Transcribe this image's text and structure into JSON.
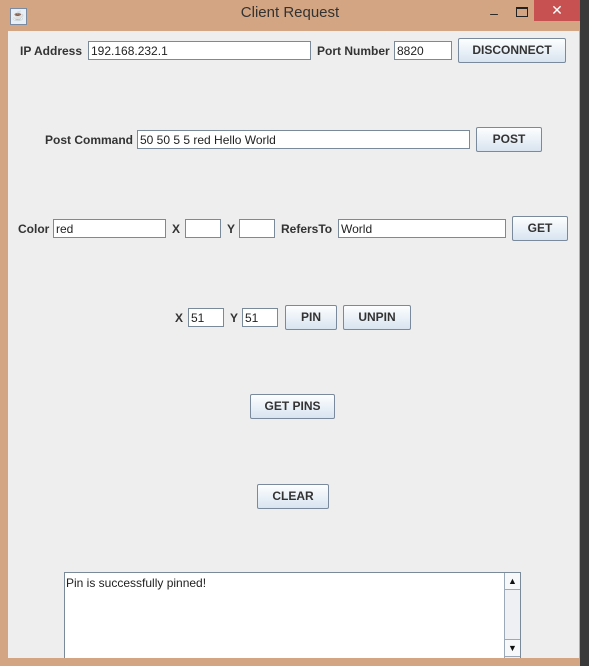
{
  "window": {
    "title": "Client Request",
    "close_glyph": "✕",
    "min_glyph": "–",
    "icon": "java-icon"
  },
  "connection": {
    "ip_label": "IP Address",
    "ip_value": "192.168.232.1",
    "port_label": "Port Number",
    "port_value": "8820",
    "disconnect_label": "DISCONNECT"
  },
  "post": {
    "label": "Post Command",
    "value": "50 50 5 5 red Hello World",
    "button": "POST"
  },
  "get": {
    "color_label": "Color",
    "color_value": "red",
    "x_label": "X",
    "x_value": "",
    "y_label": "Y",
    "y_value": "",
    "refers_label": "RefersTo",
    "refers_value": "World",
    "button": "GET"
  },
  "pin": {
    "x_label": "X",
    "x_value": "51",
    "y_label": "Y",
    "y_value": "51",
    "pin_button": "PIN",
    "unpin_button": "UNPIN"
  },
  "get_pins_button": "GET PINS",
  "clear_button": "CLEAR",
  "output": {
    "text": "Pin is successfully pinned!"
  }
}
